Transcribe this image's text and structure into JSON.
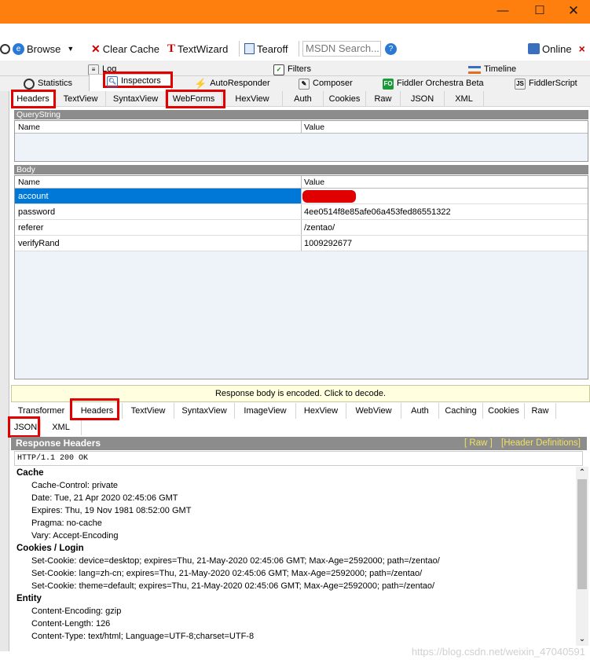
{
  "toolbar": {
    "browse": "Browse",
    "clear_cache": "Clear Cache",
    "textwizard": "TextWizard",
    "tearoff": "Tearoff",
    "msdn_search": "MSDN Search...",
    "online": "Online",
    "close": "×"
  },
  "top_tabs": {
    "log": "Log",
    "filters": "Filters",
    "timeline": "Timeline",
    "statistics": "Statistics",
    "inspectors": "Inspectors",
    "autoresponder": "AutoResponder",
    "composer": "Composer",
    "fiddler_orchestra": "Fiddler Orchestra Beta",
    "fiddlerscript": "FiddlerScript"
  },
  "request_tabs": [
    "Headers",
    "TextView",
    "SyntaxView",
    "WebForms",
    "HexView",
    "Auth",
    "Cookies",
    "Raw",
    "JSON",
    "XML"
  ],
  "querystring": {
    "title": "QueryString",
    "col_name": "Name",
    "col_value": "Value"
  },
  "body": {
    "title": "Body",
    "col_name": "Name",
    "col_value": "Value",
    "rows": [
      {
        "name": "account",
        "value": ""
      },
      {
        "name": "password",
        "value": "4ee0514f8e85afe06a453fed86551322"
      },
      {
        "name": "referer",
        "value": "/zentao/"
      },
      {
        "name": "verifyRand",
        "value": "1009292677"
      }
    ]
  },
  "notice": "Response body is encoded. Click to decode.",
  "response_tabs": [
    "Transformer",
    "Headers",
    "TextView",
    "SyntaxView",
    "ImageView",
    "HexView",
    "WebView",
    "Auth",
    "Caching",
    "Cookies",
    "Raw"
  ],
  "response_tabs2": [
    "JSON",
    "XML"
  ],
  "response_headers": {
    "title": "Response Headers",
    "raw_link": "[ Raw ]",
    "defs_link": "[Header Definitions]",
    "status_line": "HTTP/1.1 200 OK",
    "groups": [
      {
        "name": "Cache",
        "items": [
          "Cache-Control: private",
          "Date: Tue, 21 Apr 2020 02:45:06 GMT",
          "Expires: Thu, 19 Nov 1981 08:52:00 GMT",
          "Pragma: no-cache",
          "Vary: Accept-Encoding"
        ]
      },
      {
        "name": "Cookies / Login",
        "items": [
          "Set-Cookie: device=desktop; expires=Thu, 21-May-2020 02:45:06 GMT; Max-Age=2592000; path=/zentao/",
          "Set-Cookie: lang=zh-cn; expires=Thu, 21-May-2020 02:45:06 GMT; Max-Age=2592000; path=/zentao/",
          "Set-Cookie: theme=default; expires=Thu, 21-May-2020 02:45:06 GMT; Max-Age=2592000; path=/zentao/"
        ]
      },
      {
        "name": "Entity",
        "items": [
          "Content-Encoding: gzip",
          "Content-Length: 126",
          "Content-Type: text/html; Language=UTF-8;charset=UTF-8"
        ]
      }
    ]
  },
  "watermark": "https://blog.csdn.net/weixin_47040591",
  "colors": {
    "titlebar": "#ff7f0e",
    "highlight": "#e00000",
    "selection": "#0078d7"
  }
}
